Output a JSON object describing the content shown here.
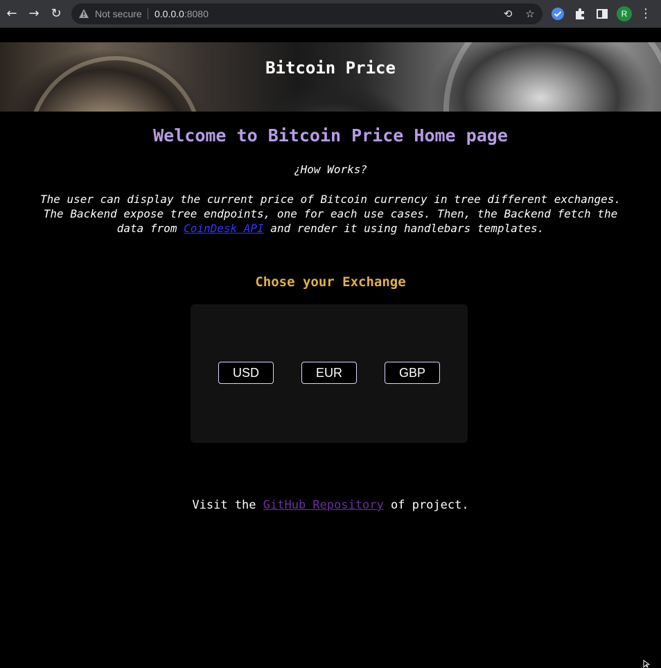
{
  "browser": {
    "security_label": "Not secure",
    "url_host": "0.0.0.0",
    "url_port": ":8080",
    "profile_initial": "R"
  },
  "banner": {
    "title": "Bitcoin Price"
  },
  "main": {
    "welcome_heading": "Welcome to Bitcoin Price Home page",
    "how_heading": "¿How Works?",
    "desc_part1": "The user can display the current price of Bitcoin currency in tree different exchanges. The Backend expose tree endpoints, one for each use cases. Then, the Backend fetch the data from ",
    "desc_link": "CoinDesk API",
    "desc_part2": " and render it using handlebars templates.",
    "exchange_heading": "Chose your Exchange",
    "exchanges": [
      {
        "label": "USD"
      },
      {
        "label": "EUR"
      },
      {
        "label": "GBP"
      }
    ]
  },
  "footer": {
    "prefix": "Visit the ",
    "link": "GitHub Repository",
    "suffix": " of project."
  },
  "colors": {
    "welcome": "#b89ce6",
    "exchange_heading": "#e2b04a",
    "desc_link": "#3434ff",
    "footer_link": "#6c2fa3",
    "panel_bg": "#121212"
  }
}
